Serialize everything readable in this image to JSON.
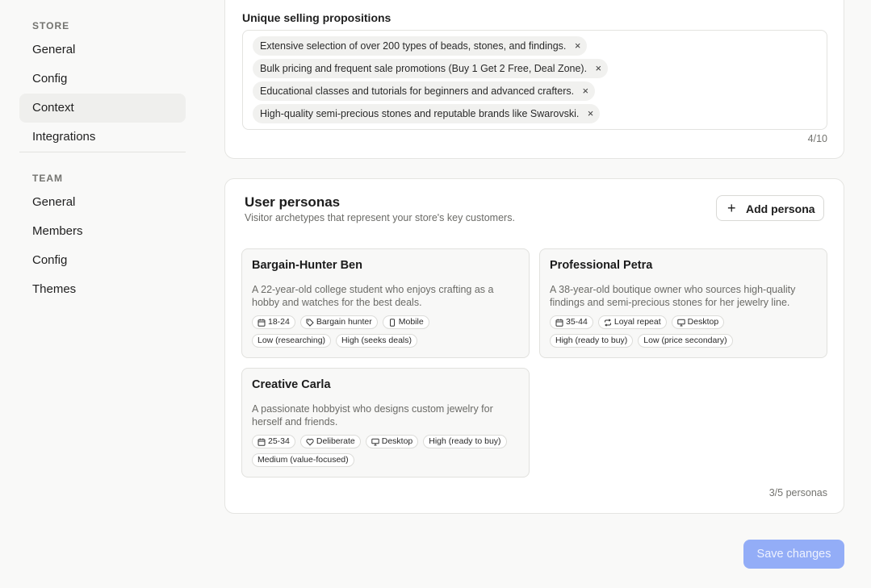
{
  "sidebar": {
    "store_heading": "STORE",
    "store_items": [
      {
        "label": "General"
      },
      {
        "label": "Config"
      },
      {
        "label": "Context"
      },
      {
        "label": "Integrations"
      }
    ],
    "team_heading": "TEAM",
    "team_items": [
      {
        "label": "General"
      },
      {
        "label": "Members"
      },
      {
        "label": "Config"
      },
      {
        "label": "Themes"
      }
    ]
  },
  "usp": {
    "label": "Unique selling propositions",
    "tags": [
      "Extensive selection of over 200 types of beads, stones, and findings.",
      "Bulk pricing and frequent sale promotions (Buy 1 Get 2 Free, Deal Zone).",
      "Educational classes and tutorials for beginners and advanced crafters.",
      "High-quality semi-precious stones and reputable brands like Swarovski."
    ],
    "remove_glyph": "×",
    "count": "4/10"
  },
  "personas_section": {
    "title": "User personas",
    "subtitle": "Visitor archetypes that represent your store's key customers.",
    "add_label": "Add persona",
    "count": "3/5 personas",
    "personas": [
      {
        "name": "Bargain-Hunter Ben",
        "description": "A 22-year-old college student who enjoys crafting as a hobby and watches for the best deals.",
        "age": "18-24",
        "behavior": "Bargain hunter",
        "behavior_icon": "tag-icon",
        "device": "Mobile",
        "device_icon": "mobile-icon",
        "intent": "Low (researching)",
        "price_sensitivity": "High (seeks deals)"
      },
      {
        "name": "Professional Petra",
        "description": "A 38-year-old boutique owner who sources high-quality findings and semi-precious stones for her jewelry line.",
        "age": "35-44",
        "behavior": "Loyal repeat",
        "behavior_icon": "repeat-icon",
        "device": "Desktop",
        "device_icon": "desktop-icon",
        "intent": "High (ready to buy)",
        "price_sensitivity": "Low (price secondary)"
      },
      {
        "name": "Creative Carla",
        "description": "A passionate hobbyist who designs custom jewelry for herself and friends.",
        "age": "25-34",
        "behavior": "Deliberate",
        "behavior_icon": "heart-icon",
        "device": "Desktop",
        "device_icon": "desktop-icon",
        "intent": "High (ready to buy)",
        "price_sensitivity": "Medium (value-focused)"
      }
    ]
  },
  "footer": {
    "save_label": "Save changes"
  },
  "colors": {
    "accent_disabled": "#93adf7",
    "active_nav_bg": "#efefed"
  }
}
